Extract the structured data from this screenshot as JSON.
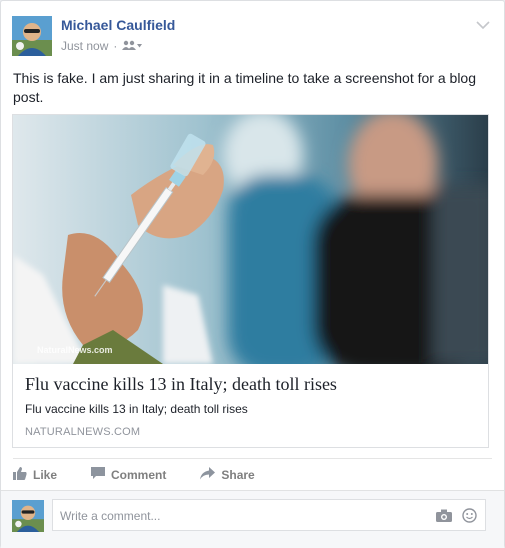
{
  "post": {
    "author": "Michael Caulfield",
    "timestamp": "Just now",
    "separator": "·",
    "audience_icon": "friends-icon",
    "text": "This is fake. I am just sharing it in a timeline to take a screenshot for a blog post."
  },
  "link_card": {
    "image_watermark": "NaturalNews.com",
    "title": "Flu vaccine kills 13 in Italy; death toll rises",
    "description": "Flu vaccine kills 13 in Italy; death toll rises",
    "domain": "NATURALNEWS.COM"
  },
  "actions": {
    "like": "Like",
    "comment": "Comment",
    "share": "Share"
  },
  "comment_box": {
    "placeholder": "Write a comment..."
  },
  "colors": {
    "author": "#365899",
    "muted": "#90949c",
    "action": "#7f7f7f"
  }
}
